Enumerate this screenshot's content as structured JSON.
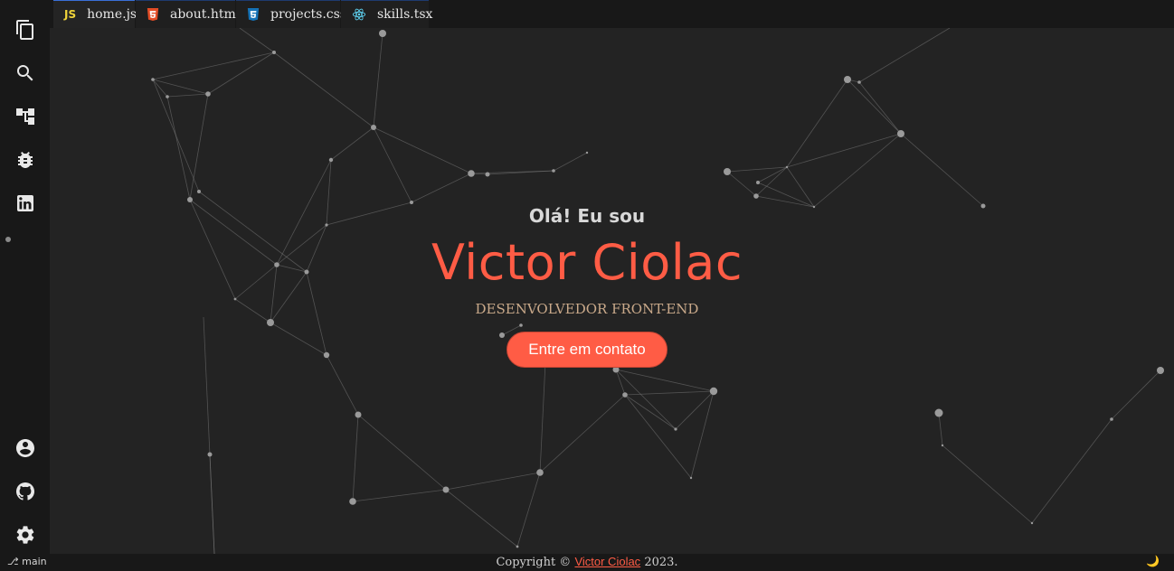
{
  "tabs": [
    {
      "label": "home.js",
      "icon": "javascript-icon",
      "active": true
    },
    {
      "label": "about.html",
      "icon": "html5-icon",
      "active": false
    },
    {
      "label": "projects.css",
      "icon": "css3-icon",
      "active": false
    },
    {
      "label": "skills.tsx",
      "icon": "react-icon",
      "active": false
    }
  ],
  "tab_icon_text": {
    "js": "JS"
  },
  "activity_bar": {
    "top": [
      "files-icon",
      "search-icon",
      "source-tree-icon",
      "debug-bug-icon",
      "linkedin-icon"
    ],
    "bottom": [
      "account-icon",
      "github-icon",
      "settings-gear-icon"
    ]
  },
  "hero": {
    "greeting": "Olá! Eu sou",
    "name": "Victor Ciolac",
    "role": "DESENVOLVEDOR FRONT-END",
    "cta_label": "Entre em contato"
  },
  "statusbar": {
    "branch": "⎇ main",
    "copyright_prefix": "Copyright ©",
    "copyright_name": "Victor Ciolac",
    "copyright_year": "2023.",
    "theme_icon": "moon-icon"
  },
  "colors": {
    "accent": "#ff5c45",
    "role_text": "#c9a98a",
    "background": "#232323",
    "sidebar": "#181818"
  }
}
